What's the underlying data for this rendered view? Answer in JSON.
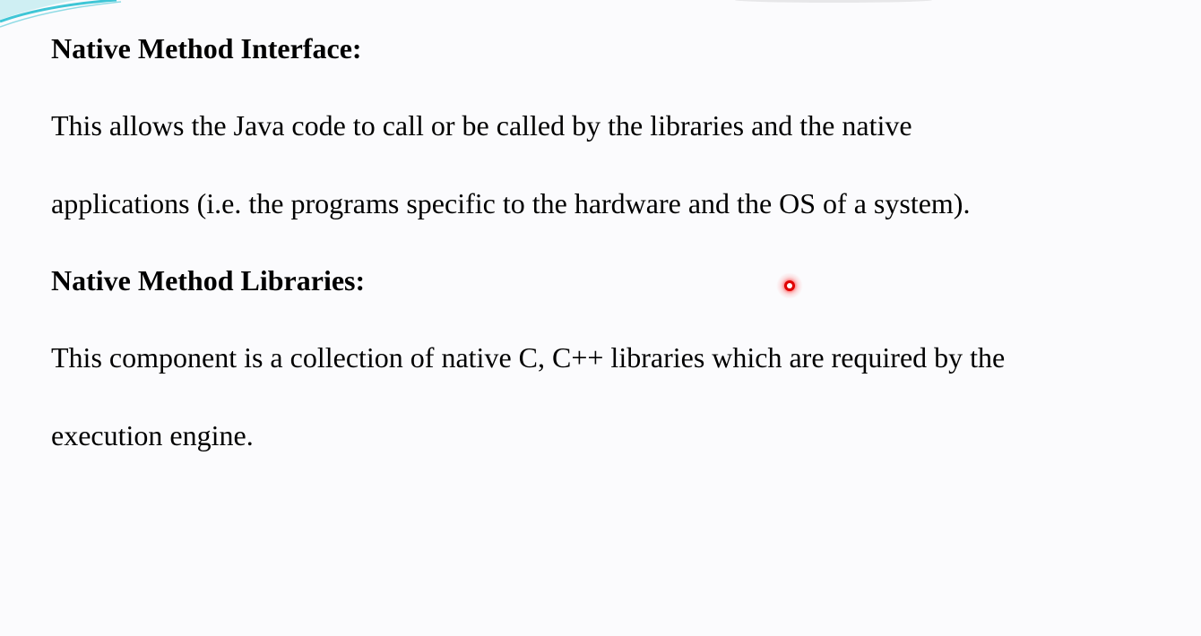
{
  "slide": {
    "section1": {
      "heading": "Native Method Interface:",
      "line1": "This  allows the Java code to call or be called by the libraries and the native",
      "line2": "applications (i.e. the programs specific to the hardware and the OS of a system)."
    },
    "section2": {
      "heading": "Native Method Libraries:",
      "line1": "This component is a collection of native C, C++ libraries which are required by the",
      "line2": "execution engine."
    }
  },
  "decorations": {
    "corner_icon": "corner-swoosh-icon",
    "pointer_icon": "laser-pointer-icon",
    "accent_color": "#3fc6d6",
    "pointer_color": "#e00000"
  }
}
